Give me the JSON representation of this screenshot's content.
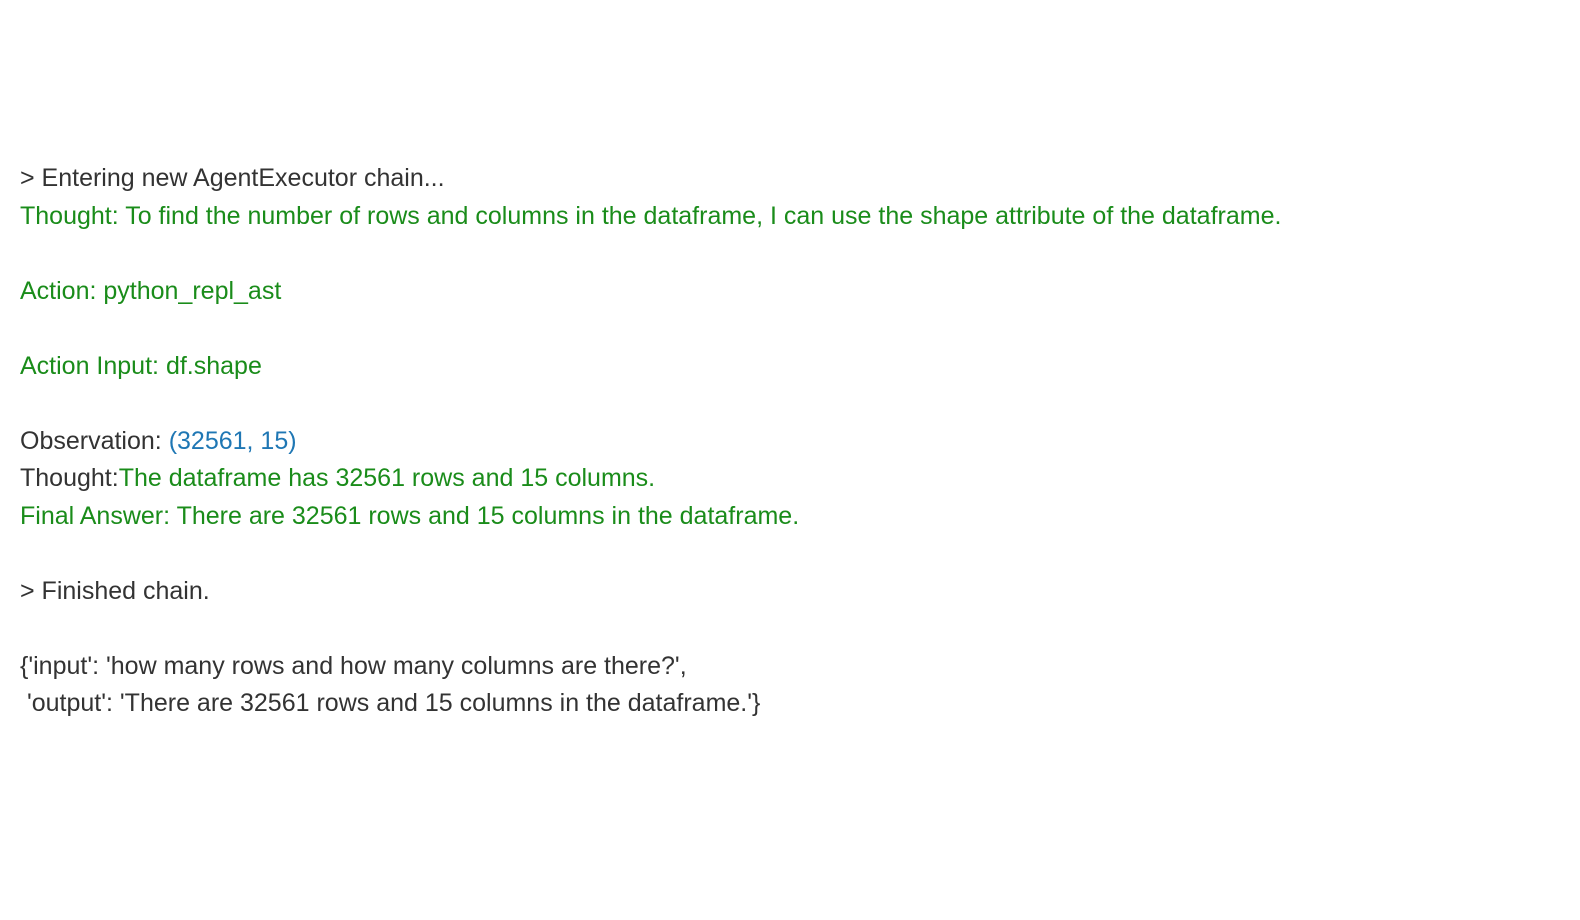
{
  "log": {
    "enter_prefix": "> ",
    "enter_text": "Entering new AgentExecutor chain...",
    "thought1_label": "Thought: ",
    "thought1_text": "To find the number of rows and columns in the dataframe, I can use the shape attribute of the dataframe.",
    "action_label": "Action: ",
    "action_value": "python_repl_ast",
    "action_input_label": "Action Input: ",
    "action_input_value": "df.shape",
    "observation_label": "Observation: ",
    "observation_value": "(32561, 15)",
    "thought2_label": "Thought:",
    "thought2_text": "The dataframe has 32561 rows and 15 columns.",
    "final_label": "Final Answer: ",
    "final_text": "There are 32561 rows and 15 columns in the dataframe.",
    "finish_prefix": "> ",
    "finish_text": "Finished chain.",
    "result_line1": "{'input': 'how many rows and how many columns are there?',",
    "result_line2": " 'output': 'There are 32561 rows and 15 columns in the dataframe.'}"
  }
}
